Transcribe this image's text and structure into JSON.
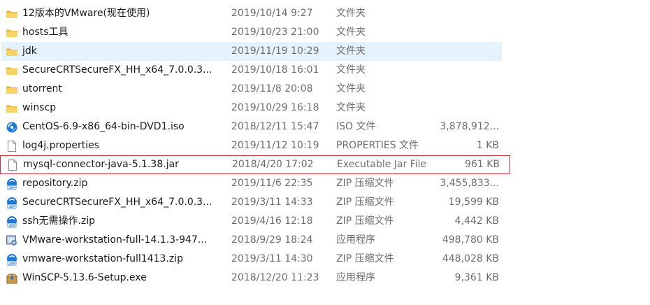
{
  "files": [
    {
      "name": "12版本的VMware(现在使用)",
      "date": "2019/10/14 9:27",
      "type": "文件夹",
      "size": "",
      "icon": "folder-icon"
    },
    {
      "name": "hosts工具",
      "date": "2019/10/23 21:00",
      "type": "文件夹",
      "size": "",
      "icon": "folder-icon"
    },
    {
      "name": "jdk",
      "date": "2019/11/19 10:29",
      "type": "文件夹",
      "size": "",
      "icon": "folder-icon"
    },
    {
      "name": "SecureCRTSecureFX_HH_x64_7.0.0.3...",
      "date": "2019/10/18 16:01",
      "type": "文件夹",
      "size": "",
      "icon": "folder-icon"
    },
    {
      "name": "utorrent",
      "date": "2019/11/8 20:08",
      "type": "文件夹",
      "size": "",
      "icon": "folder-icon"
    },
    {
      "name": "winscp",
      "date": "2019/10/29 16:18",
      "type": "文件夹",
      "size": "",
      "icon": "folder-icon"
    },
    {
      "name": "CentOS-6.9-x86_64-bin-DVD1.iso",
      "date": "2018/12/11 15:47",
      "type": "ISO 文件",
      "size": "3,878,912...",
      "icon": "iso-disc-icon"
    },
    {
      "name": "log4j.properties",
      "date": "2019/11/12 10:19",
      "type": "PROPERTIES 文件",
      "size": "1 KB",
      "icon": "document-icon"
    },
    {
      "name": "mysql-connector-java-5.1.38.jar",
      "date": "2018/4/20 17:02",
      "type": "Executable Jar File",
      "size": "961 KB",
      "icon": "document-icon"
    },
    {
      "name": "repository.zip",
      "date": "2019/11/6 22:35",
      "type": "ZIP 压缩文件",
      "size": "3,455,833...",
      "icon": "zip-icon"
    },
    {
      "name": "SecureCRTSecureFX_HH_x64_7.0.0.3...",
      "date": "2019/3/11 14:33",
      "type": "ZIP 压缩文件",
      "size": "19,599 KB",
      "icon": "zip-icon"
    },
    {
      "name": "ssh无需操作.zip",
      "date": "2019/4/16 12:18",
      "type": "ZIP 压缩文件",
      "size": "4,442 KB",
      "icon": "zip-icon"
    },
    {
      "name": "VMware-workstation-full-14.1.3-947...",
      "date": "2018/9/29 18:24",
      "type": "应用程序",
      "size": "498,780 KB",
      "icon": "installer-icon"
    },
    {
      "name": "vmware-workstation-full1413.zip",
      "date": "2019/3/11 14:30",
      "type": "ZIP 压缩文件",
      "size": "448,028 KB",
      "icon": "zip-icon"
    },
    {
      "name": "WinSCP-5.13.6-Setup.exe",
      "date": "2018/12/20 11:23",
      "type": "应用程序",
      "size": "9,361 KB",
      "icon": "setup-installer-icon"
    }
  ],
  "hovered_row": "jdk",
  "outlined_row": "mysql-connector-java-5.1.38.jar",
  "colors": {
    "hover_background": "#e5f3ff",
    "outline_border": "#c8303a",
    "folder_yellow": "#f5c542",
    "detail_text": "#6d6d6d",
    "name_text": "#1a1a1a"
  }
}
